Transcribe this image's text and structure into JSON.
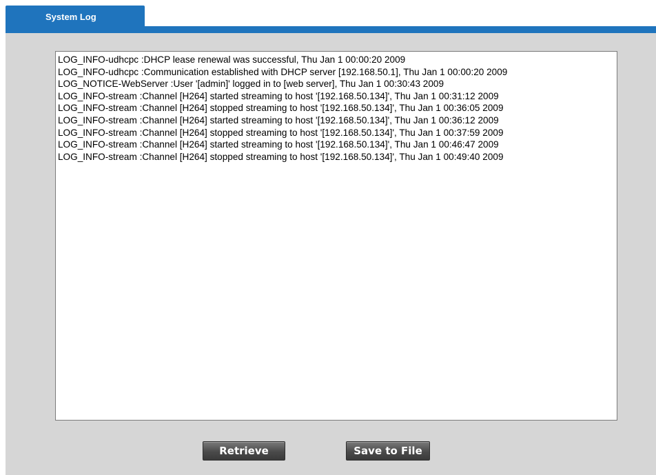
{
  "tab": {
    "label": "System Log"
  },
  "log": {
    "lines": [
      "LOG_INFO-udhcpc :DHCP lease renewal was successful, Thu Jan 1 00:00:20 2009",
      "LOG_INFO-udhcpc :Communication established with DHCP server [192.168.50.1], Thu Jan 1 00:00:20 2009",
      "LOG_NOTICE-WebServer :User '[admin]' logged in to [web server], Thu Jan 1 00:30:43 2009",
      "LOG_INFO-stream :Channel [H264] started streaming to host '[192.168.50.134]', Thu Jan 1 00:31:12 2009",
      "LOG_INFO-stream :Channel [H264] stopped streaming to host '[192.168.50.134]', Thu Jan 1 00:36:05 2009",
      "LOG_INFO-stream :Channel [H264] started streaming to host '[192.168.50.134]', Thu Jan 1 00:36:12 2009",
      "LOG_INFO-stream :Channel [H264] stopped streaming to host '[192.168.50.134]', Thu Jan 1 00:37:59 2009",
      "LOG_INFO-stream :Channel [H264] started streaming to host '[192.168.50.134]', Thu Jan 1 00:46:47 2009",
      "LOG_INFO-stream :Channel [H264] stopped streaming to host '[192.168.50.134]', Thu Jan 1 00:49:40 2009"
    ]
  },
  "buttons": {
    "retrieve_label": "Retrieve",
    "save_label": "Save to File"
  },
  "colors": {
    "tab_blue": "#1f74bd",
    "panel_gray": "#d6d6d6",
    "button_dark": "#4a4a4a"
  }
}
